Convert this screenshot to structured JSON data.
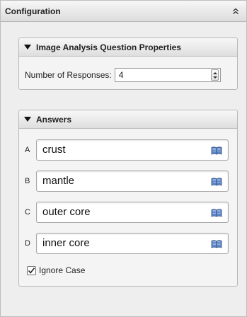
{
  "panel": {
    "title": "Configuration",
    "collapse_icon": "double-chevron-up-icon"
  },
  "properties": {
    "title": "Image Analysis Question Properties",
    "responses_label": "Number of Responses:",
    "responses_value": "4"
  },
  "answers": {
    "title": "Answers",
    "items": [
      {
        "letter": "A",
        "value": "crust"
      },
      {
        "letter": "B",
        "value": "mantle"
      },
      {
        "letter": "C",
        "value": "outer core"
      },
      {
        "letter": "D",
        "value": "inner core"
      }
    ],
    "ignore_case_label": "Ignore Case",
    "ignore_case_checked": true,
    "book_icon": "book-icon"
  }
}
